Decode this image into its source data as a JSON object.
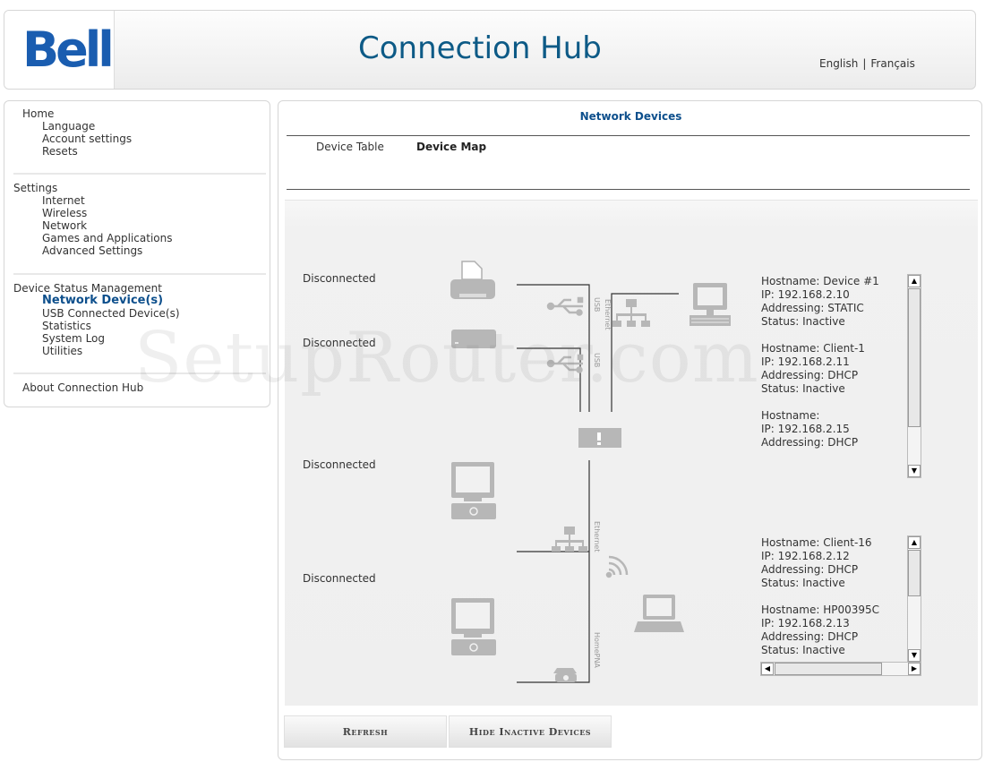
{
  "header": {
    "logo": "Bell",
    "title": "Connection Hub",
    "lang_english": "English",
    "lang_separator": "|",
    "lang_french": "Français"
  },
  "sidebar": {
    "home": {
      "label": "Home",
      "items": [
        "Language",
        "Account settings",
        "Resets"
      ]
    },
    "settings": {
      "label": "Settings",
      "items": [
        "Internet",
        "Wireless",
        "Network",
        "Games and Applications",
        "Advanced Settings"
      ]
    },
    "device_status": {
      "label": "Device Status Management",
      "active_item": "Network Device(s)",
      "items": [
        "Network Device(s)",
        "USB Connected Device(s)",
        "Statistics",
        "System Log",
        "Utilities"
      ]
    },
    "about": "About Connection Hub"
  },
  "main": {
    "title": "Network Devices",
    "tabs": [
      {
        "label": "Device Table",
        "active": false
      },
      {
        "label": "Device Map",
        "active": true
      }
    ],
    "map": {
      "status_labels": [
        "Disconnected",
        "Disconnected",
        "Disconnected",
        "Disconnected"
      ],
      "link_labels": [
        "USB",
        "USB",
        "Ethernet",
        "Ethernet",
        "HomePNA"
      ],
      "wired_devices": [
        {
          "hostname": "Hostname: Device #1",
          "ip": "IP: 192.168.2.10",
          "addressing": "Addressing: STATIC",
          "status": "Status: Inactive"
        },
        {
          "hostname": "Hostname: Client-1",
          "ip": "IP: 192.168.2.11",
          "addressing": "Addressing: DHCP",
          "status": "Status: Inactive"
        },
        {
          "hostname": "Hostname:",
          "ip": "IP: 192.168.2.15",
          "addressing": "Addressing: DHCP",
          "status": ""
        }
      ],
      "wireless_devices": [
        {
          "hostname": "Hostname: Client-16",
          "ip": "IP: 192.168.2.12",
          "addressing": "Addressing: DHCP",
          "status": "Status: Inactive"
        },
        {
          "hostname": "Hostname: HP00395C",
          "ip": "IP: 192.168.2.13",
          "addressing": "Addressing: DHCP",
          "status": "Status: Inactive"
        }
      ]
    },
    "buttons": {
      "refresh": "Refresh",
      "hide_inactive": "Hide Inactive Devices"
    }
  },
  "watermark": "SetupRouter.com",
  "colors": {
    "brand_blue": "#1a5db0",
    "title_blue": "#0d5a86",
    "link_blue": "#0d4f8c",
    "icon_gray": "#b3b3b3",
    "line": "#333333"
  }
}
